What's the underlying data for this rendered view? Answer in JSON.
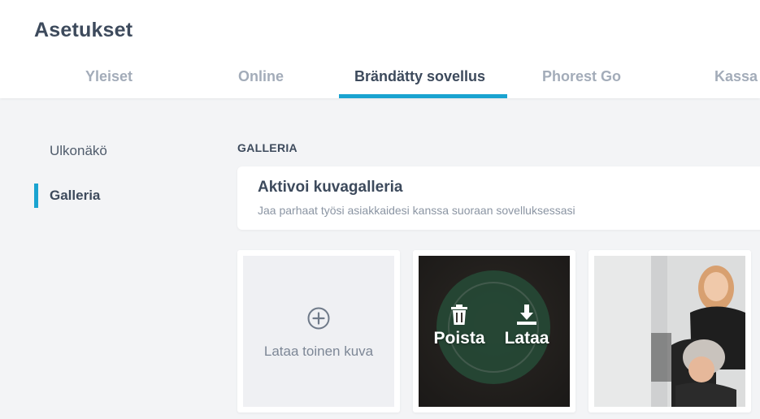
{
  "header": {
    "title": "Asetukset",
    "tabs": [
      {
        "label": "Yleiset",
        "active": false
      },
      {
        "label": "Online",
        "active": false
      },
      {
        "label": "Brändätty sovellus",
        "active": true
      },
      {
        "label": "Phorest Go",
        "active": false
      },
      {
        "label": "Kassa",
        "active": false
      }
    ]
  },
  "sidebar": {
    "items": [
      {
        "label": "Ulkonäkö",
        "active": false
      },
      {
        "label": "Galleria",
        "active": true
      }
    ]
  },
  "main": {
    "section_label": "GALLERIA",
    "gallery_card": {
      "title": "Aktivoi kuvagalleria",
      "subtitle": "Jaa parhaat työsi asiakkaidesi kanssa suoraan sovelluksessasi"
    },
    "tiles": {
      "upload_label": "Lataa toinen kuva",
      "delete_label": "Poista",
      "download_label": "Lataa"
    }
  },
  "colors": {
    "accent": "#1aa3d0",
    "text_primary": "#3d4a5c",
    "text_muted": "#a3acb9",
    "background": "#f3f4f6"
  },
  "icons": {
    "upload": "plus-circle-icon",
    "delete": "trash-icon",
    "download": "download-icon"
  }
}
